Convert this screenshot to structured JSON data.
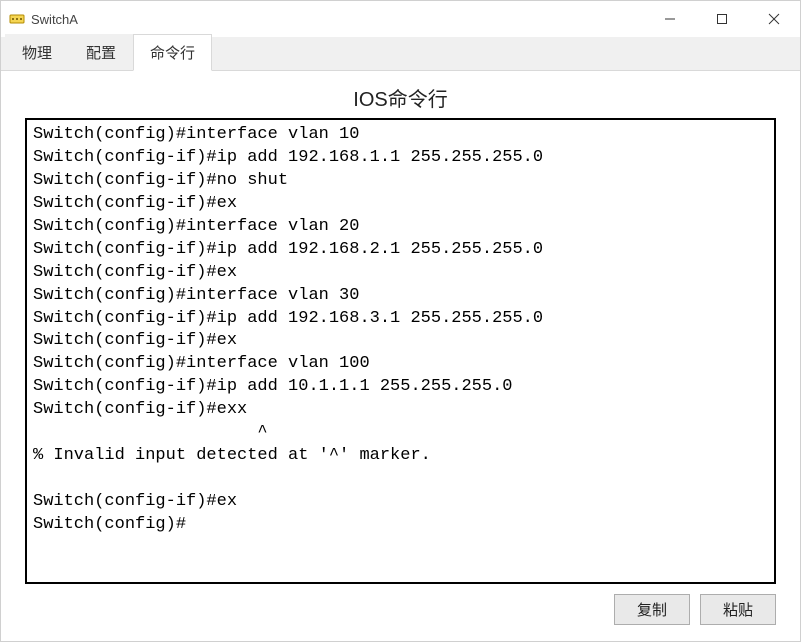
{
  "window": {
    "title": "SwitchA"
  },
  "tabs": {
    "t0": "物理",
    "t1": "配置",
    "t2": "命令行",
    "activeIndex": 2
  },
  "panel": {
    "title": "IOS命令行"
  },
  "terminal": {
    "text": "Switch(config)#interface vlan 10\nSwitch(config-if)#ip add 192.168.1.1 255.255.255.0\nSwitch(config-if)#no shut\nSwitch(config-if)#ex\nSwitch(config)#interface vlan 20\nSwitch(config-if)#ip add 192.168.2.1 255.255.255.0\nSwitch(config-if)#ex\nSwitch(config)#interface vlan 30\nSwitch(config-if)#ip add 192.168.3.1 255.255.255.0\nSwitch(config-if)#ex\nSwitch(config)#interface vlan 100\nSwitch(config-if)#ip add 10.1.1.1 255.255.255.0\nSwitch(config-if)#exx\n                      ^\n% Invalid input detected at '^' marker.\n\nSwitch(config-if)#ex\nSwitch(config)#"
  },
  "buttons": {
    "copy": "复制",
    "paste": "粘贴"
  }
}
